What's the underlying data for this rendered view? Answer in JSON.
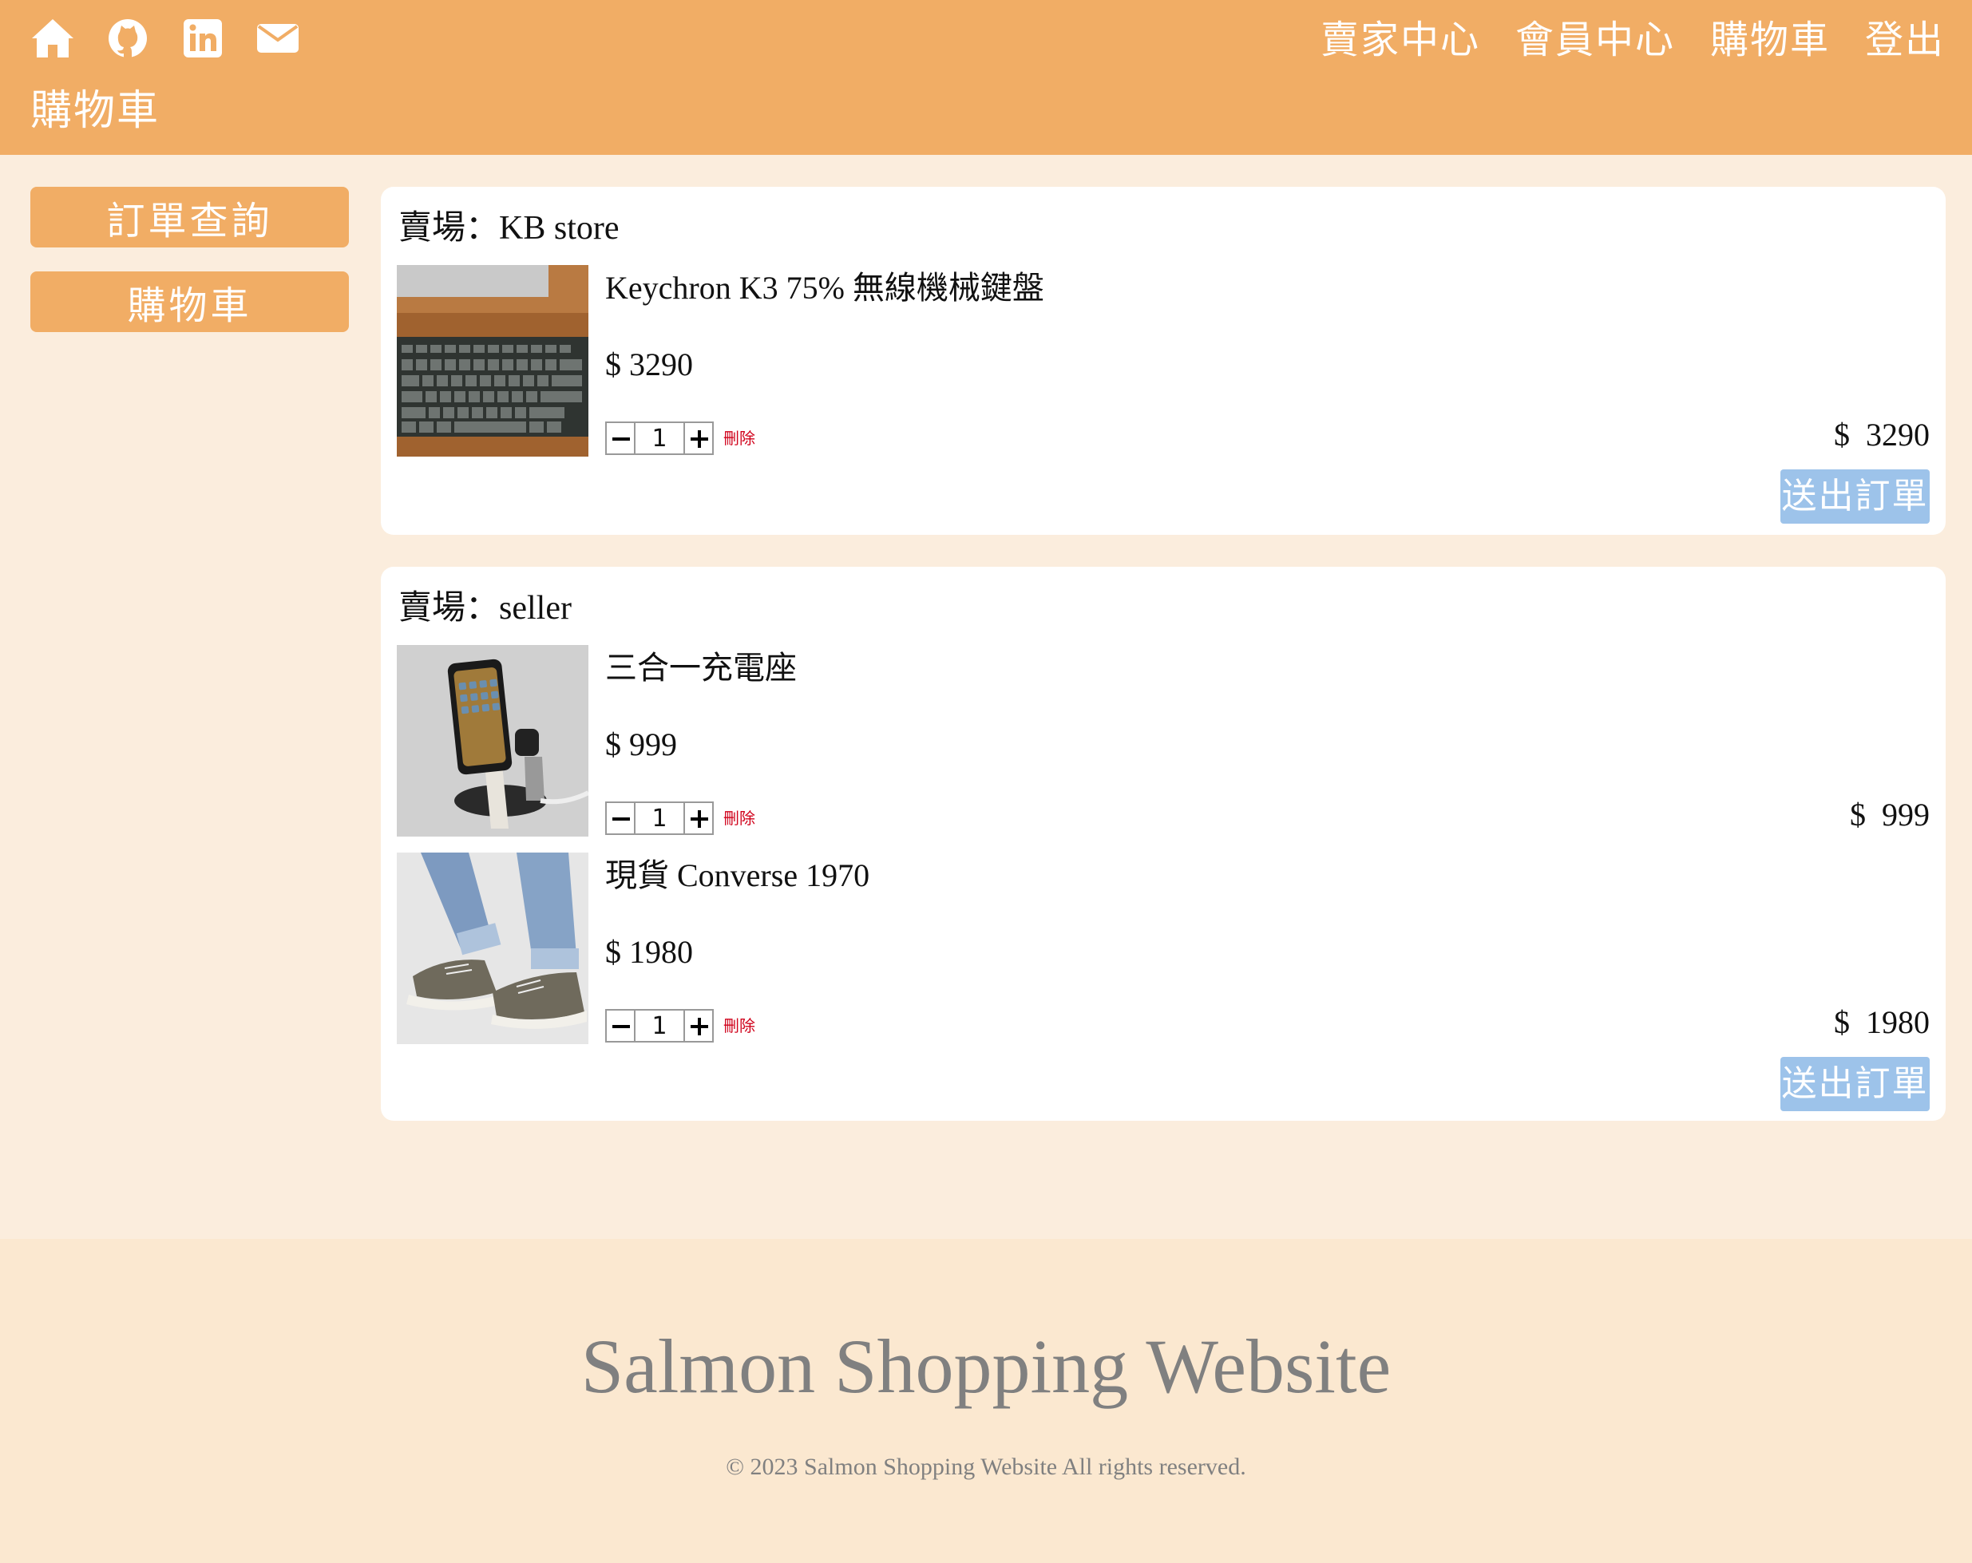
{
  "header": {
    "icons": [
      "home-icon",
      "github-icon",
      "linkedin-icon",
      "mail-icon"
    ],
    "nav": [
      "賣家中心",
      "會員中心",
      "購物車",
      "登出"
    ],
    "page_title": "購物車"
  },
  "sidebar": {
    "items": [
      {
        "label": "訂單查詢"
      },
      {
        "label": "購物車"
      }
    ]
  },
  "stores": [
    {
      "label": "賣場：KB store",
      "submit_label": "送出訂單",
      "items": [
        {
          "name": "Keychron K3 75% 無線機械鍵盤",
          "price": "$ 3290",
          "qty": "1",
          "delete_label": "刪除",
          "subtotal": "$  3290"
        }
      ]
    },
    {
      "label": "賣場：seller",
      "submit_label": "送出訂單",
      "items": [
        {
          "name": "三合一充電座",
          "price": "$ 999",
          "qty": "1",
          "delete_label": "刪除",
          "subtotal": "$  999"
        },
        {
          "name": "現貨 Converse 1970",
          "price": "$ 1980",
          "qty": "1",
          "delete_label": "刪除",
          "subtotal": "$  1980"
        }
      ]
    }
  ],
  "footer": {
    "title": "Salmon Shopping Website",
    "copyright": "© 2023 Salmon Shopping Website All rights reserved."
  },
  "colors": {
    "header_bg": "#f1ad65",
    "page_bg": "#fbeddd",
    "footer_bg": "#fbe8d0",
    "submit_bg": "#9dc3ea",
    "delete_text": "#d0021b"
  }
}
